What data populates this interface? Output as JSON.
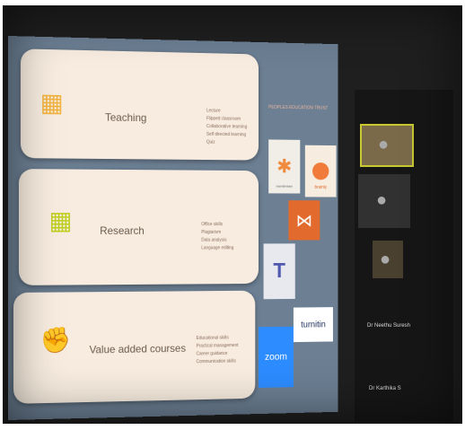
{
  "slide": {
    "logo_text": "PEOPLES EDUCATION TRUST",
    "cards": [
      {
        "icon": "teaching-icon",
        "title": "Teaching",
        "items": [
          "Lecture",
          "Flipped classroom",
          "Collaborative learning",
          "Self directed learning",
          "Quiz"
        ]
      },
      {
        "icon": "research-icon",
        "title": "Research",
        "items": [
          "Office skills",
          "Plagiarism",
          "Data analysis",
          "Language editing"
        ]
      },
      {
        "icon": "raised-fist-icon",
        "title": "Value added courses",
        "items": [
          "Educational skills",
          "Practical management",
          "Career guidance",
          "Communication skills"
        ]
      }
    ],
    "tools": {
      "mentimeter": "mentimeter",
      "brainly": "brainly",
      "turnitin": "turnitin",
      "zoom": "zoom"
    }
  },
  "participants": [
    {
      "name": "",
      "subtitle": ""
    },
    {
      "name": "",
      "subtitle": ""
    },
    {
      "name": "",
      "subtitle": ""
    },
    {
      "name": "Dr Neethu Suresh",
      "subtitle": ""
    },
    {
      "name": "Dr Karthika S",
      "subtitle": ""
    }
  ],
  "colors": {
    "card_bg": "#f7ecdf",
    "slide_bg": "#6c7f93",
    "teaching_icon": "#f2b23d",
    "research_icon": "#bfcf1e",
    "value_icon": "#caa64d",
    "zoom_blue": "#2d8cff",
    "moodle_orange": "#e26a2c",
    "speaker_border": "#c8c830"
  }
}
